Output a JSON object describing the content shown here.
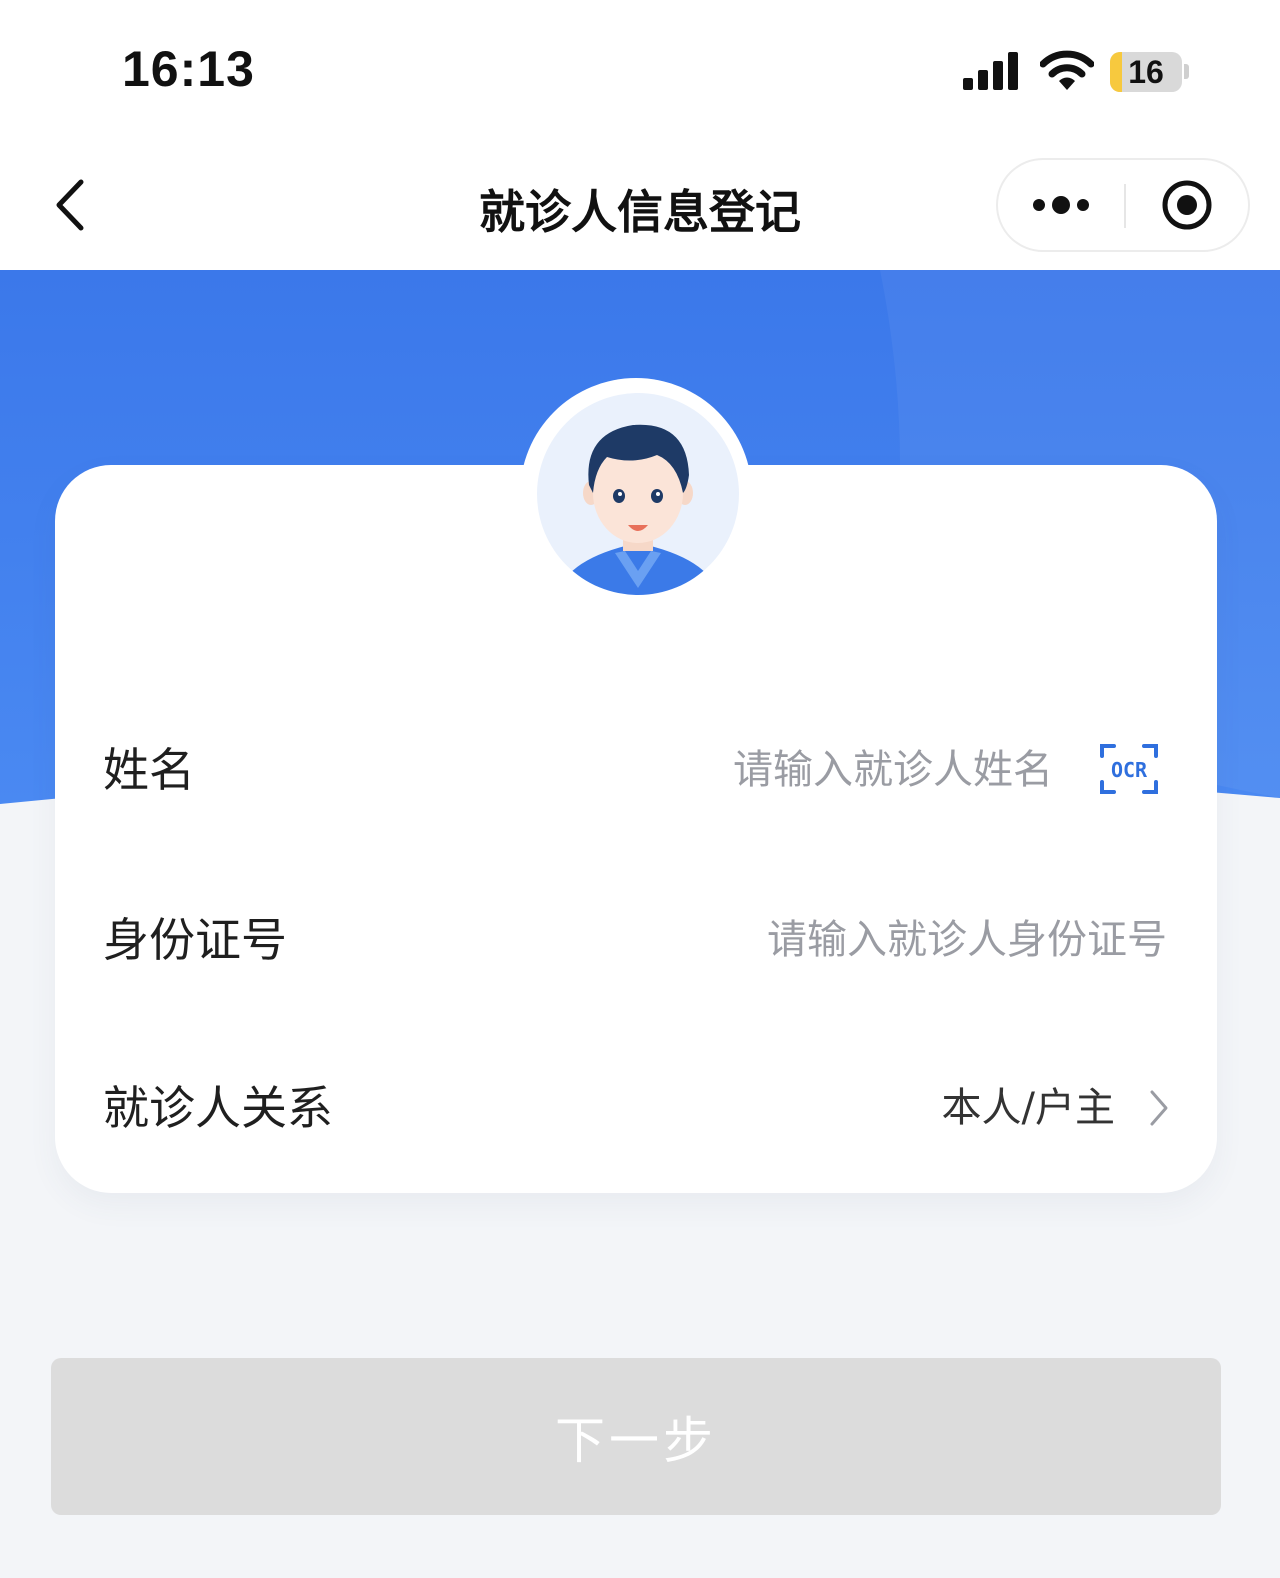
{
  "status_bar": {
    "time": "16:13",
    "battery_level": "16",
    "battery_fraction": 0.16,
    "icons": [
      "signal-icon",
      "wifi-icon",
      "battery-icon"
    ]
  },
  "nav": {
    "title": "就诊人信息登记",
    "icons": [
      "chevron-left-icon",
      "more-icon",
      "record-icon"
    ]
  },
  "form": {
    "name": {
      "label": "姓名",
      "placeholder": "请输入就诊人姓名",
      "ocr_label": "OCR"
    },
    "id_number": {
      "label": "身份证号",
      "placeholder": "请输入就诊人身份证号"
    },
    "relation": {
      "label": "就诊人关系",
      "value": "本人/户主"
    }
  },
  "next_button": {
    "label": "下一步",
    "enabled": false
  },
  "colors": {
    "header_blue": "#3d7bea",
    "page_background": "#f3f5f8",
    "disabled_button": "#dcdcdc",
    "placeholder_gray": "#9a9ca3"
  }
}
